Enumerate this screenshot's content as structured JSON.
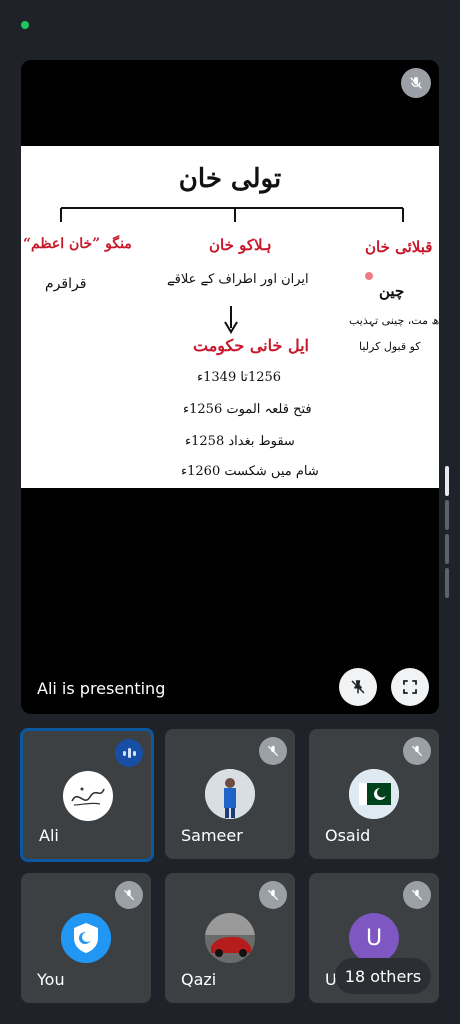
{
  "stage": {
    "presenting_label": "Ali is presenting",
    "slide": {
      "title": "تولی خان",
      "left_heading": "منگو ”خان اعظم“",
      "left_sub": "قراقرم",
      "center_heading": "ہلاکو خان",
      "center_sub": "ایران اور اطراف کے علاقے",
      "center_result": "ایل خانی حکومت",
      "center_points": [
        "1256تا 1349ء",
        "فتح قلعہ الموت 1256ء",
        "سقوط بغداد 1258ء",
        "شام میں شکست 1260ء"
      ],
      "right_heading": "قبلائی خان",
      "right_sub": "چین",
      "right_line1": "بدھ مت، چینی تہذیب",
      "right_line2": "کو قبول کرلیا",
      "arrow": "↓"
    }
  },
  "participants": [
    {
      "name": "Ali",
      "state": "speaking"
    },
    {
      "name": "Sameer",
      "state": "muted"
    },
    {
      "name": "Osaid",
      "state": "muted"
    },
    {
      "name": "You",
      "state": "muted"
    },
    {
      "name": "Qazi",
      "state": "muted"
    },
    {
      "name": "Us",
      "state": "muted",
      "initial": "U"
    }
  ],
  "others_label": "18 others",
  "colors": {
    "accent_border": "#0b57a0",
    "slide_red": "#c8192c",
    "status_green": "#20c55e",
    "avatar_purple": "#7e57c2"
  }
}
